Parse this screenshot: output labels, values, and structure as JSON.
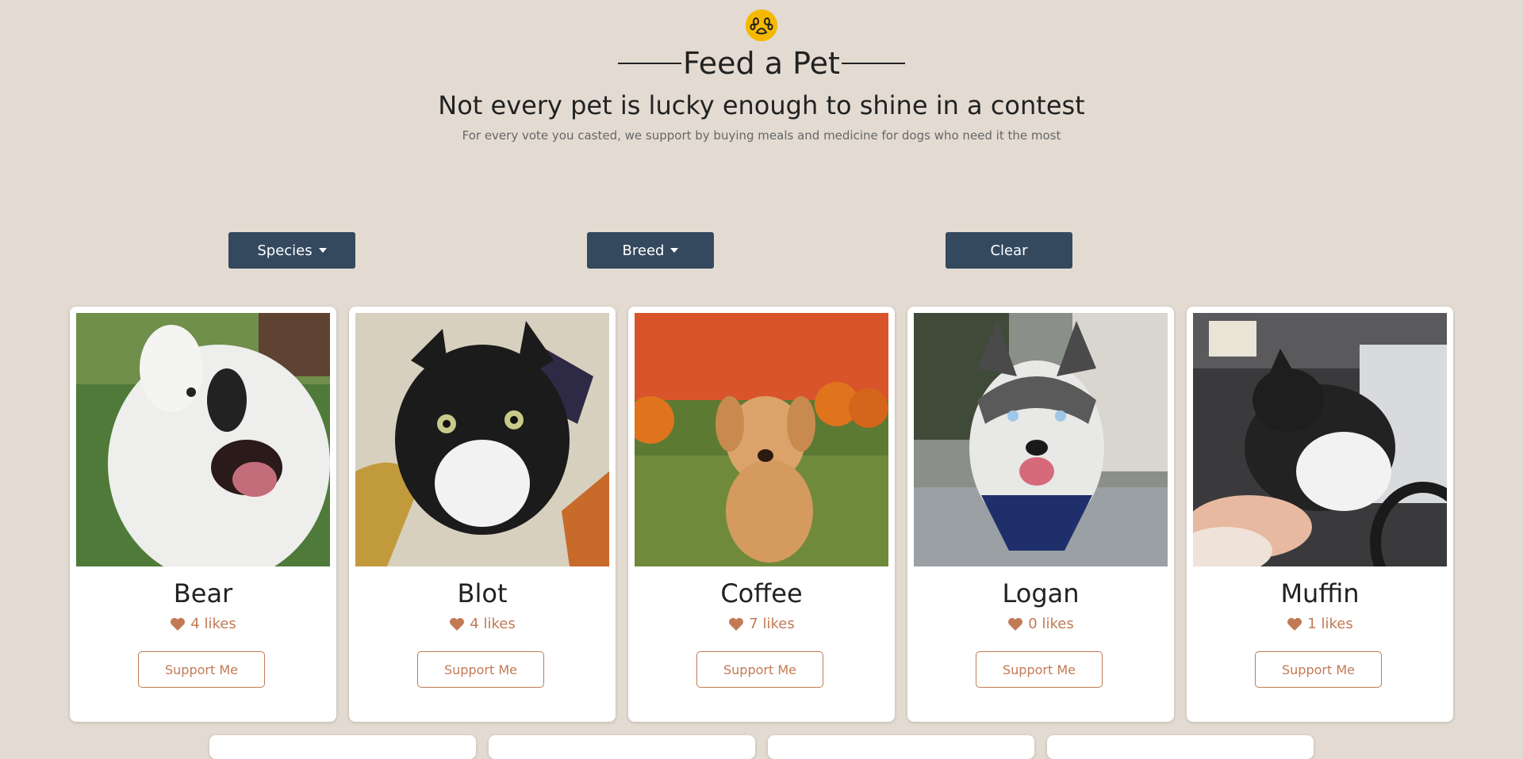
{
  "header": {
    "icon": "paw-icon",
    "title": "Feed a Pet",
    "subtitle": "Not every pet is lucky enough to shine in a contest",
    "tagline": "For every vote you casted, we support by buying meals and medicine for dogs who need it the most"
  },
  "filters": {
    "species_label": "Species",
    "breed_label": "Breed",
    "clear_label": "Clear"
  },
  "colors": {
    "background": "#e3dbd1",
    "button_dark": "#34495e",
    "accent": "#c27a55",
    "paw_badge": "#f5b800"
  },
  "pets": [
    {
      "name": "Bear",
      "likes": "4 likes",
      "support_label": "Support Me"
    },
    {
      "name": "Blot",
      "likes": "4 likes",
      "support_label": "Support Me"
    },
    {
      "name": "Coffee",
      "likes": "7 likes",
      "support_label": "Support Me"
    },
    {
      "name": "Logan",
      "likes": "0 likes",
      "support_label": "Support Me"
    },
    {
      "name": "Muffin",
      "likes": "1 likes",
      "support_label": "Support Me"
    }
  ]
}
